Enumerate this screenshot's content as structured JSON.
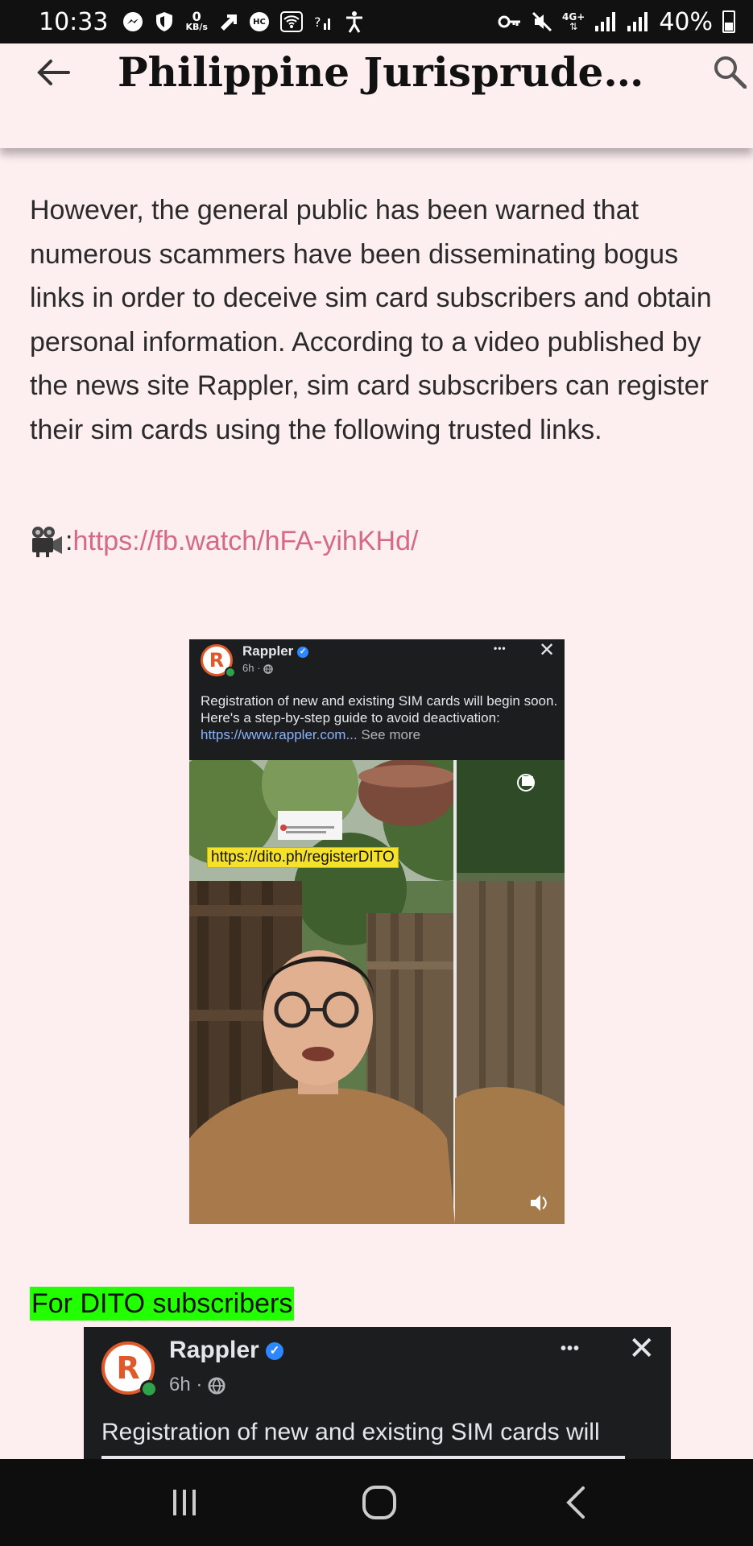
{
  "status_bar": {
    "time": "10:33",
    "speed_value": "0",
    "speed_unit": "KB/s",
    "hc_badge": "HC",
    "network_type": "4G+",
    "battery_text": "40%",
    "icons": [
      "messenger-icon",
      "shield-icon",
      "data-speed-icon",
      "upload-arrow-icon",
      "hc-icon",
      "wifi-icon",
      "signal-icon",
      "accessibility-icon",
      "key-icon",
      "mute-icon",
      "network-icon",
      "signal-bars-icon",
      "signal-bars-icon",
      "battery-icon"
    ]
  },
  "app_bar": {
    "title": "Philippine Jurisprudenc...",
    "back_icon": "back-arrow-icon",
    "search_icon": "search-icon"
  },
  "article": {
    "paragraph": "However, the general public has been warned that numerous scammers have been disseminating bogus links in order to deceive sim card subscribers and obtain personal information. According to a video published by the news site Rappler, sim card subscribers can register their sim cards using the following trusted links.",
    "video_prefix": ": ",
    "video_link": "https://fb.watch/hFA-yihKHd/",
    "video_icon": "movie-camera-icon"
  },
  "embed_video": {
    "page_name": "Rappler",
    "time": "6h · ",
    "text": "Registration of new and existing SIM cards will begin soon. Here's a step-by-step guide to avoid deactivation: ",
    "link": "https://www.rappler.com...",
    "see_more": " See more",
    "overlay_url": "https://dito.ph/registerDITO",
    "menu_dots": "•••",
    "close": "✕"
  },
  "section_label": "For DITO subscribers",
  "embed_image": {
    "page_name": "Rappler",
    "time": "6h · ",
    "text": "Registration of new and existing SIM cards will",
    "menu_dots": "•••",
    "close": "✕"
  },
  "colors": {
    "background": "#fdeef0",
    "link": "#d46a86",
    "highlight": "#22ff00",
    "facebook_dark": "#1c1d1f"
  }
}
